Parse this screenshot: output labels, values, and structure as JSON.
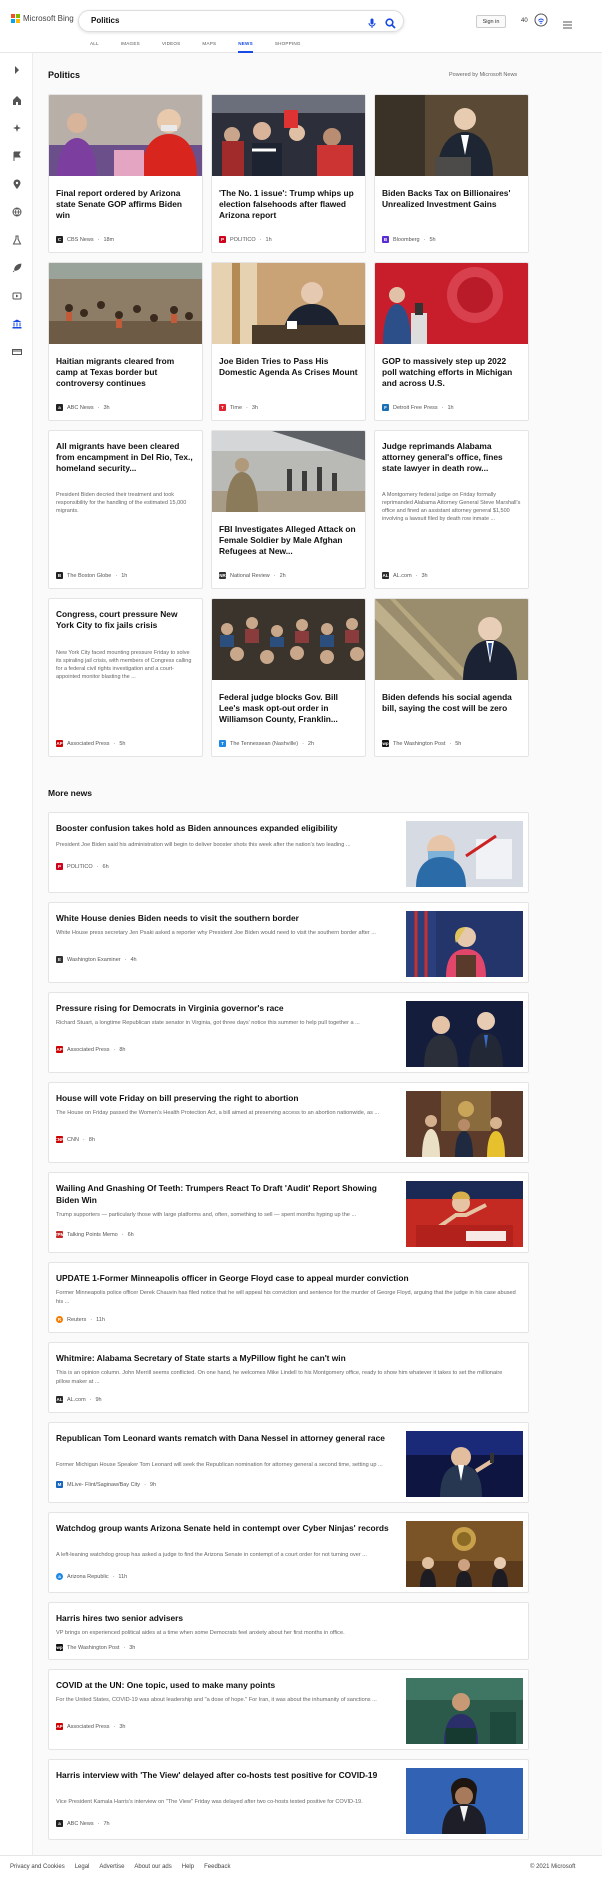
{
  "header": {
    "logo_text": "Microsoft Bing",
    "search_value": "Politics",
    "signin_label": "Sign in",
    "rewards_count": "40",
    "tabs": [
      {
        "label": "ALL"
      },
      {
        "label": "IMAGES"
      },
      {
        "label": "VIDEOS"
      },
      {
        "label": "MAPS"
      },
      {
        "label": "NEWS",
        "active": true
      },
      {
        "label": "SHOPPING"
      }
    ]
  },
  "sidebar": {
    "icons": [
      "expand-icon",
      "home-icon",
      "discover-icon",
      "flag-icon",
      "location-icon",
      "globe-icon",
      "science-icon",
      "rocket-icon",
      "entertainment-icon",
      "politics-icon",
      "money-icon"
    ]
  },
  "section": {
    "title": "Politics",
    "powered_by": "Powered by Microsoft News"
  },
  "cards": [
    {
      "title": "Final report ordered by Arizona state Senate GOP affirms Biden win",
      "source": "CBS News",
      "time": "18m",
      "logo": "C",
      "logo_color": "#222222"
    },
    {
      "title": "'The No. 1 issue': Trump whips up election falsehoods after flawed Arizona report",
      "source": "POLITICO",
      "time": "1h",
      "logo": "P",
      "logo_color": "#d0021b"
    },
    {
      "title": "Biden Backs Tax on Billionaires' Unrealized Investment Gains",
      "source": "Bloomberg",
      "time": "5h",
      "logo": "B",
      "logo_color": "#5b2bd6"
    },
    {
      "title": "Haitian migrants cleared from camp at Texas border but controversy continues",
      "source": "ABC News",
      "time": "3h",
      "logo": "a",
      "logo_color": "#222222"
    },
    {
      "title": "Joe Biden Tries to Pass His Domestic Agenda As Crises Mount",
      "source": "Time",
      "time": "3h",
      "logo": "T",
      "logo_color": "#e0232c"
    },
    {
      "title": "GOP to massively step up 2022 poll watching efforts in Michigan and across U.S.",
      "source": "Detroit Free Press",
      "time": "1h",
      "logo": "F",
      "logo_color": "#1a6fb5"
    },
    {
      "title": "All migrants have been cleared from encampment in Del Rio, Tex., homeland security...",
      "desc": "President Biden decried their treatment and took responsibility for the handling of the estimated 15,000 migrants.",
      "source": "The Boston Globe",
      "time": "1h",
      "logo": "B",
      "logo_color": "#222222"
    },
    {
      "title": "FBI Investigates Alleged Attack on Female Soldier by Male Afghan Refugees at New...",
      "source": "National Review",
      "time": "2h",
      "logo": "NR",
      "logo_color": "#333333"
    },
    {
      "title": "Judge reprimands Alabama attorney general's office, fines state lawyer in death row...",
      "desc": "A Montgomery federal judge on Friday formally reprimanded Alabama Attorney General Steve Marshall's office and fined an assistant attorney general $1,500 involving a lawsuit filed by death row inmate ...",
      "source": "AL.com",
      "time": "3h",
      "logo": "AL",
      "logo_color": "#2b2b2b"
    },
    {
      "title": "Congress, court pressure New York City to fix jails crisis",
      "desc": "New York City faced mounting pressure Friday to solve its spiraling jail crisis, with members of Congress calling for a federal civil rights investigation and a court-appointed monitor blasting the ...",
      "source": "Associated Press",
      "time": "5h",
      "logo": "AP",
      "logo_color": "#cc0000"
    },
    {
      "title": "Federal judge blocks Gov. Bill Lee's mask opt-out order in Williamson County, Franklin...",
      "source": "The Tennessean (Nashville)",
      "time": "2h",
      "logo": "T",
      "logo_color": "#1e88e5"
    },
    {
      "title": "Biden defends his social agenda bill, saying the cost will be zero",
      "source": "The Washington Post",
      "time": "5h",
      "logo": "wp",
      "logo_color": "#111111"
    }
  ],
  "more_news": {
    "title": "More news",
    "items": [
      {
        "title": "Booster confusion takes hold as Biden announces expanded eligibility",
        "desc": "President Joe Biden said his administration will begin to deliver booster shots this week after the nation's two leading ...",
        "source": "POLITICO",
        "time": "6h",
        "logo": "P",
        "logo_color": "#d0021b"
      },
      {
        "title": "White House denies Biden needs to visit the southern border",
        "desc": "White House press secretary Jen Psaki asked a reporter why President Joe Biden would need to visit the southern border after ...",
        "source": "Washington Examiner",
        "time": "4h",
        "logo": "E",
        "logo_color": "#333333"
      },
      {
        "title": "Pressure rising for Democrats in Virginia governor's race",
        "desc": "Richard Stuart, a longtime Republican state senator in Virginia, got three days' notice this summer to help pull together a ...",
        "source": "Associated Press",
        "time": "8h",
        "logo": "AP",
        "logo_color": "#cc0000"
      },
      {
        "title": "House will vote Friday on bill preserving the right to abortion",
        "desc": "The House on Friday passed the Women's Health Protection Act, a bill aimed at preserving access to an abortion nationwide, as ...",
        "source": "CNN",
        "time": "8h",
        "logo": "CNN",
        "logo_color": "#cc0000"
      },
      {
        "title": "Wailing And Gnashing Of Teeth: Trumpers React To Draft 'Audit' Report Showing Biden Win",
        "desc": "Trump supporters — particularly those with large platforms and, often, something to sell — spent months hyping up the ...",
        "source": "Talking Points Memo",
        "time": "6h",
        "logo": "TPM",
        "logo_color": "#c62828"
      },
      {
        "title": "UPDATE 1-Former Minneapolis officer in George Floyd case to appeal murder conviction",
        "desc": "Former Minneapolis police officer Derek Chauvin has filed notice that he will appeal his conviction and sentence for the murder of George Floyd, arguing that the judge in his case abused his ...",
        "source": "Reuters",
        "time": "11h",
        "logo": "R",
        "logo_color": "#f57c00"
      },
      {
        "title": "Whitmire: Alabama Secretary of State starts a MyPillow fight he can't win",
        "desc": "This is an opinion column. John Merrill seems conflicted. On one hand, he welcomes Mike Lindell to his Montgomery office, ready to show him whatever it takes to set the millionaire pillow maker at ...",
        "source": "AL.com",
        "time": "9h",
        "logo": "AL",
        "logo_color": "#2b2b2b"
      },
      {
        "title": "Republican Tom Leonard wants rematch with Dana Nessel in attorney general race",
        "desc": "Former Michigan House Speaker Tom Leonard will seek the Republican nomination for attorney general a second time, setting up ...",
        "source": "MLive- Flint/Saginaw/Bay City",
        "time": "9h",
        "logo": "M",
        "logo_color": "#1565c0"
      },
      {
        "title": "Watchdog group wants Arizona Senate held in contempt over Cyber Ninjas' records",
        "desc": "A left-leaning watchdog group has asked a judge to find the Arizona Senate in contempt of a court order for not turning over ...",
        "source": "Arizona Republic",
        "time": "11h",
        "logo": "a",
        "logo_color": "#1e88e5"
      },
      {
        "title": "Harris hires two senior advisers",
        "desc": "VP brings on experienced political aides at a time when some Democrats feel anxiety about her first months in office.",
        "source": "The Washington Post",
        "time": "3h",
        "logo": "wp",
        "logo_color": "#111111"
      },
      {
        "title": "COVID at the UN: One topic, used to make many points",
        "desc": "For the United States, COVID-19 was about leadership and \"a dose of hope.\" For Iran, it was about the inhumanity of sanctions ...",
        "source": "Associated Press",
        "time": "3h",
        "logo": "AP",
        "logo_color": "#cc0000"
      },
      {
        "title": "Harris interview with 'The View' delayed after co-hosts test positive for COVID-19",
        "desc": "Vice President Kamala Harris's interview on \"The View\" Friday was delayed after two co-hosts tested positive for COVID-19.",
        "source": "ABC News",
        "time": "7h",
        "logo": "a",
        "logo_color": "#222222"
      }
    ]
  },
  "footer": {
    "links": [
      "Privacy and Cookies",
      "Legal",
      "Advertise",
      "About our ads",
      "Help",
      "Feedback"
    ],
    "copyright": "© 2021 Microsoft"
  }
}
